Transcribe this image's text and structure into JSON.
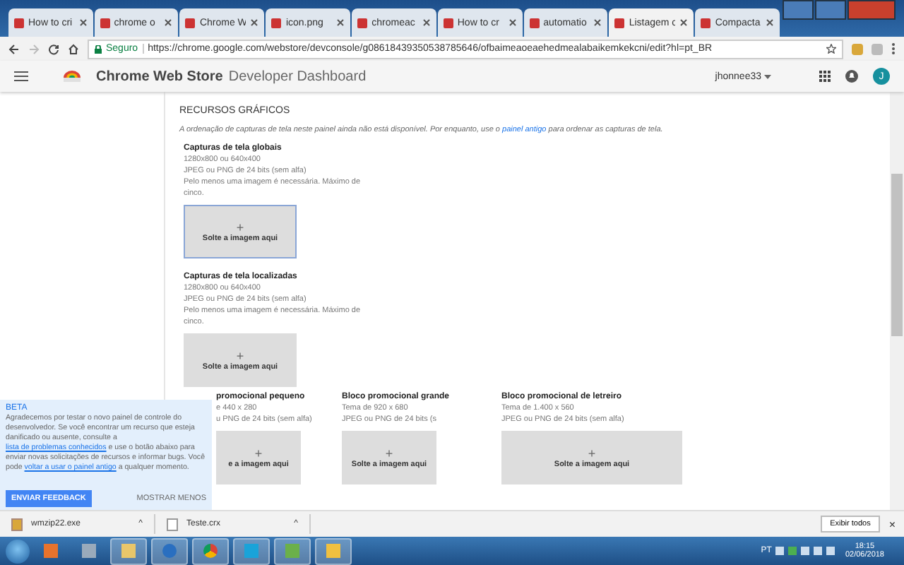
{
  "tabs": [
    {
      "label": "How to cri",
      "selected": false
    },
    {
      "label": "chrome o",
      "selected": false
    },
    {
      "label": "Chrome W",
      "selected": false
    },
    {
      "label": "icon.png",
      "selected": false
    },
    {
      "label": "chromeac",
      "selected": false
    },
    {
      "label": "How to cr",
      "selected": false
    },
    {
      "label": "automatio",
      "selected": false
    },
    {
      "label": "Listagem c",
      "selected": true
    },
    {
      "label": "Compacta",
      "selected": false
    }
  ],
  "address_bar": {
    "security": "Seguro",
    "url": "https://chrome.google.com/webstore/devconsole/g08618439350538785646/ofbaimeaoeaehedmealabaikemkekcni/edit?hl=pt_BR"
  },
  "header": {
    "title": "Chrome Web Store",
    "subtitle": "Developer Dashboard",
    "user": "jhonnee33",
    "avatar": "J"
  },
  "section": {
    "title": "RECURSOS GRÁFICOS",
    "note": [
      {
        "kind": "text",
        "text": "A ordenação de capturas de tela neste painel ainda não está disponível. Por enquanto, use o "
      },
      {
        "kind": "link",
        "text": "painel antigo"
      },
      {
        "kind": "text",
        "text": " para ordenar as capturas de tela."
      }
    ]
  },
  "screenshot_groups": [
    {
      "title": "Capturas de tela globais",
      "lines": [
        "1280x800 ou 640x400",
        "JPEG ou PNG de 24 bits (sem alfa)",
        "Pelo menos uma imagem é necessária. Máximo de cinco."
      ],
      "drop": {
        "plus": "+",
        "label": "Solte a imagem aqui",
        "selected": true
      }
    },
    {
      "title": "Capturas de tela localizadas",
      "lines": [
        "1280x800 ou 640x400",
        "JPEG ou PNG de 24 bits (sem alfa)",
        "Pelo menos uma imagem é necessária. Máximo de cinco."
      ],
      "drop": {
        "plus": "+",
        "label": "Solte a imagem aqui",
        "selected": false
      }
    }
  ],
  "promo_tiles": [
    {
      "title": "promocional pequeno",
      "lines": [
        "e 440 x 280",
        "u PNG de 24 bits (sem alfa)"
      ],
      "drop": {
        "plus": "+",
        "label": "e a imagem aqui"
      }
    },
    {
      "title": "Bloco promocional grande",
      "lines": [
        "Tema de 920 x 680",
        "JPEG ou PNG de 24 bits (s"
      ],
      "drop": {
        "plus": "+",
        "label": "Solte a imagem aqui"
      }
    },
    {
      "title": "Bloco promocional de letreiro",
      "lines": [
        "Tema de 1.400 x 560",
        "JPEG ou PNG de 24 bits (sem alfa)"
      ],
      "drop": {
        "plus": "+",
        "label": "Solte a imagem aqui"
      }
    }
  ],
  "beta": {
    "title": "BETA",
    "body": [
      {
        "kind": "text",
        "text": "Agradecemos por testar o novo painel de controle do desenvolvedor. Se você encontrar um recurso que esteja danificado ou ausente, consulte a "
      },
      {
        "kind": "link",
        "text": "lista de problemas conhecidos"
      },
      {
        "kind": "text",
        "text": " e use o botão abaixo para enviar novas solicitações de recursos e informar bugs. Você pode "
      },
      {
        "kind": "link",
        "text": "voltar a usar o painel antigo"
      },
      {
        "kind": "text",
        "text": " a qualquer momento."
      }
    ],
    "primary": "ENVIAR FEEDBACK",
    "secondary": "MOSTRAR MENOS"
  },
  "downloads": {
    "items": [
      {
        "name": "wmzip22.exe",
        "caret": "^"
      },
      {
        "name": "Teste.crx",
        "caret": "^"
      }
    ],
    "show_all": "Exibir todos",
    "close": "×"
  },
  "taskbar": {
    "language": "PT",
    "time": "18:15",
    "date": "02/06/2018"
  }
}
